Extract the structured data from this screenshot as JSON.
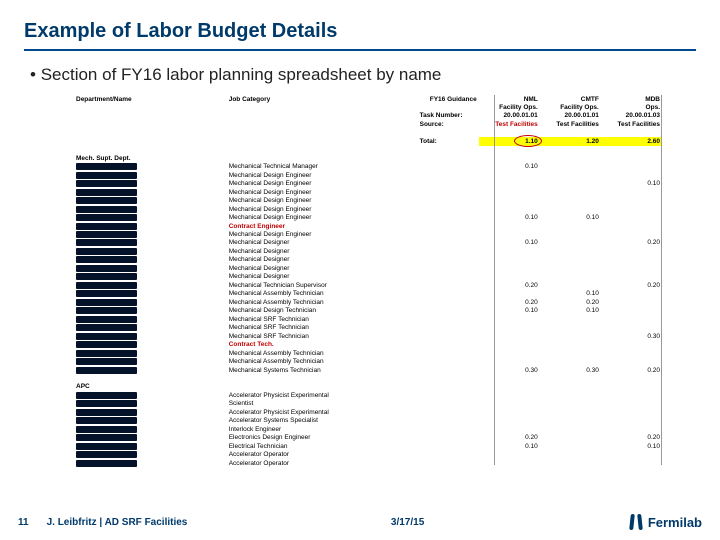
{
  "title": "Example of Labor Budget Details",
  "bullet": "Section of FY16 labor planning spreadsheet by name",
  "headers": {
    "dept": "Department/Name",
    "job": "Job Category",
    "guidance": "FY16 Guidance",
    "task": "Task Number:",
    "source": "Source:",
    "total": "Total:",
    "cols": [
      {
        "name": "NML",
        "sub": "Facility Ops.",
        "task": "20.00.01.01",
        "src": "Test Facilities"
      },
      {
        "name": "CMTF",
        "sub": "Facility Ops.",
        "task": "20.00.01.01",
        "src": "Test Facilities"
      },
      {
        "name": "MDB",
        "sub": "Ops.",
        "task": "20.00.01.03",
        "src": "Test Facilities"
      }
    ],
    "totals": [
      "1.10",
      "1.20",
      "2.60"
    ]
  },
  "sections": [
    {
      "dept": "Mech. Supt. Dept.",
      "rows": [
        {
          "job": "Mechanical Technical Manager",
          "v": [
            "0.10",
            "",
            ""
          ]
        },
        {
          "job": "Mechanical Design Engineer",
          "v": [
            "",
            "",
            ""
          ]
        },
        {
          "job": "Mechanical Design Engineer",
          "v": [
            "",
            "",
            "0.10"
          ]
        },
        {
          "job": "Mechanical Design Engineer",
          "v": [
            "",
            "",
            ""
          ]
        },
        {
          "job": "Mechanical Design Engineer",
          "v": [
            "",
            "",
            ""
          ]
        },
        {
          "job": "Mechanical Design Engineer",
          "v": [
            "",
            "",
            ""
          ]
        },
        {
          "job": "Mechanical Design Engineer",
          "v": [
            "0.10",
            "0.10",
            ""
          ]
        },
        {
          "job": "Contract Engineer",
          "v": [
            "",
            "",
            ""
          ],
          "red": true
        },
        {
          "job": "Mechanical Design Engineer",
          "v": [
            "",
            "",
            ""
          ]
        },
        {
          "job": "Mechanical Designer",
          "v": [
            "0.10",
            "",
            "0.20"
          ]
        },
        {
          "job": "Mechanical Designer",
          "v": [
            "",
            "",
            ""
          ]
        },
        {
          "job": "Mechanical Designer",
          "v": [
            "",
            "",
            ""
          ]
        },
        {
          "job": "Mechanical Designer",
          "v": [
            "",
            "",
            ""
          ]
        },
        {
          "job": "Mechanical Designer",
          "v": [
            "",
            "",
            ""
          ]
        },
        {
          "job": "Mechanical Technician Supervisor",
          "v": [
            "0.20",
            "",
            "0.20"
          ]
        },
        {
          "job": "Mechanical Assembly Technician",
          "v": [
            "",
            "0.10",
            ""
          ]
        },
        {
          "job": "Mechanical Assembly Technician",
          "v": [
            "0.20",
            "0.20",
            ""
          ]
        },
        {
          "job": "Mechanical Design Technician",
          "v": [
            "0.10",
            "0.10",
            ""
          ]
        },
        {
          "job": "Mechanical SRF Technician",
          "v": [
            "",
            "",
            ""
          ]
        },
        {
          "job": "Mechanical SRF Technician",
          "v": [
            "",
            "",
            ""
          ]
        },
        {
          "job": "Mechanical SRF Technician",
          "v": [
            "",
            "",
            "0.30"
          ]
        },
        {
          "job": "Contract Tech.",
          "v": [
            "",
            "",
            ""
          ],
          "red": true
        },
        {
          "job": "Mechanical Assembly Technician",
          "v": [
            "",
            "",
            ""
          ]
        },
        {
          "job": "Mechanical Assembly Technician",
          "v": [
            "",
            "",
            ""
          ]
        },
        {
          "job": "Mechanical Systems Technician",
          "v": [
            "0.30",
            "0.30",
            "0.20"
          ]
        }
      ]
    },
    {
      "dept": "APC",
      "rows": [
        {
          "job": "Accelerator Physicist Experimental",
          "v": [
            "",
            "",
            ""
          ]
        },
        {
          "job": "Scientist",
          "v": [
            "",
            "",
            ""
          ]
        },
        {
          "job": "Accelerator Physicist Experimental",
          "v": [
            "",
            "",
            ""
          ]
        },
        {
          "job": "Accelerator Systems Specialist",
          "v": [
            "",
            "",
            ""
          ]
        },
        {
          "job": "Interlock Engineer",
          "v": [
            "",
            "",
            ""
          ]
        },
        {
          "job": "Electronics Design Engineer",
          "v": [
            "0.20",
            "",
            "0.20"
          ]
        },
        {
          "job": "Electrical Technician",
          "v": [
            "0.10",
            "",
            "0.10"
          ]
        },
        {
          "job": "Accelerator Operator",
          "v": [
            "",
            "",
            ""
          ]
        },
        {
          "job": "Accelerator Operator",
          "v": [
            "",
            "",
            ""
          ]
        }
      ]
    }
  ],
  "footer": {
    "page": "11",
    "credit": "J. Leibfritz | AD SRF Facilities",
    "date": "3/17/15",
    "logo": "Fermilab"
  }
}
